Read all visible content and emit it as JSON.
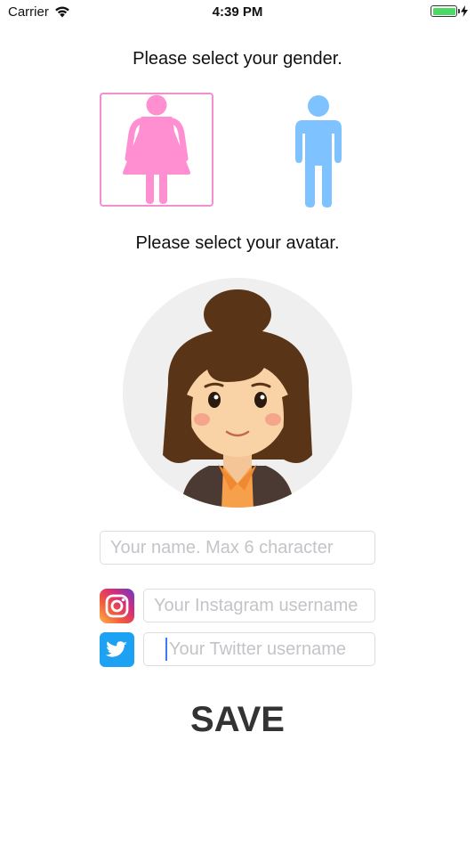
{
  "status_bar": {
    "carrier": "Carrier",
    "time": "4:39 PM",
    "battery_color": "#4cd964"
  },
  "gender": {
    "prompt": "Please select your gender.",
    "options": [
      {
        "id": "female",
        "icon": "female-figure-icon",
        "color": "#ff8fd0",
        "selected": true
      },
      {
        "id": "male",
        "icon": "male-figure-icon",
        "color": "#7ec3ff",
        "selected": false
      }
    ],
    "selected_border_color": "#f48fcf"
  },
  "avatar": {
    "prompt": "Please select your avatar."
  },
  "form": {
    "name_placeholder": "Your name. Max 6 character",
    "instagram_placeholder": "Your Instagram username",
    "twitter_placeholder": "Your Twitter username",
    "instagram_icon": "instagram-icon",
    "twitter_icon": "twitter-icon",
    "twitter_color": "#1da1f2"
  },
  "save_label": "SAVE"
}
